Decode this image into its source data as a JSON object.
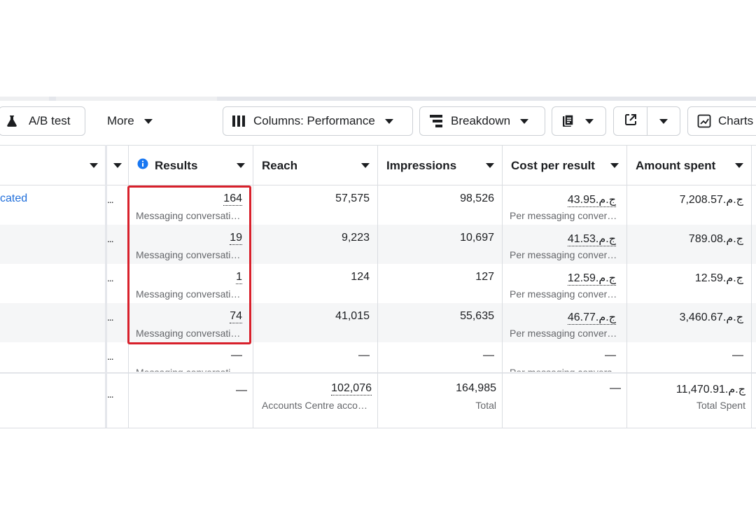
{
  "toolbar": {
    "ab_test_label": "A/B test",
    "more_label": "More",
    "columns_label": "Columns: Performance",
    "breakdown_label": "Breakdown",
    "charts_label": "Charts"
  },
  "table": {
    "headers": {
      "results": "Results",
      "reach": "Reach",
      "impressions": "Impressions",
      "cost_per_result": "Cost per result",
      "amount_spent": "Amount spent"
    },
    "rows": [
      {
        "name": "cated",
        "ellipsis": "...",
        "results": "164",
        "results_sub": "Messaging conversati…",
        "reach": "57,575",
        "impressions": "98,526",
        "cost": "43.95.ج.م",
        "cost_sub": "Per messaging conver…",
        "spent": "7,208.57.ج.م"
      },
      {
        "name": "",
        "ellipsis": "...",
        "results": "19",
        "results_sub": "Messaging conversati…",
        "reach": "9,223",
        "impressions": "10,697",
        "cost": "41.53.ج.م",
        "cost_sub": "Per messaging conver…",
        "spent": "789.08.ج.م"
      },
      {
        "name": "",
        "ellipsis": "...",
        "results": "1",
        "results_sub": "Messaging conversati…",
        "reach": "124",
        "impressions": "127",
        "cost": "12.59.ج.م",
        "cost_sub": "Per messaging conver…",
        "spent": "12.59.ج.م"
      },
      {
        "name": "",
        "ellipsis": "...",
        "results": "74",
        "results_sub": "Messaging conversati…",
        "reach": "41,015",
        "impressions": "55,635",
        "cost": "46.77.ج.م",
        "cost_sub": "Per messaging conver…",
        "spent": "3,460.67.ج.م"
      },
      {
        "name": "",
        "ellipsis": "...",
        "results": "—",
        "results_sub": "Messaging conversati…",
        "reach": "—",
        "impressions": "—",
        "cost": "—",
        "cost_sub": "Per messaging convers…",
        "spent": "—"
      }
    ],
    "totals": {
      "ellipsis": "...",
      "results": "—",
      "reach": "102,076",
      "reach_sub": "Accounts Centre acco…",
      "impressions": "164,985",
      "impressions_sub": "Total",
      "cost": "—",
      "spent": "11,470.91.ج.م",
      "spent_sub": "Total Spent"
    }
  },
  "colors": {
    "highlight": "#d8202b",
    "link": "#216fdb",
    "info": "#1877f2"
  }
}
